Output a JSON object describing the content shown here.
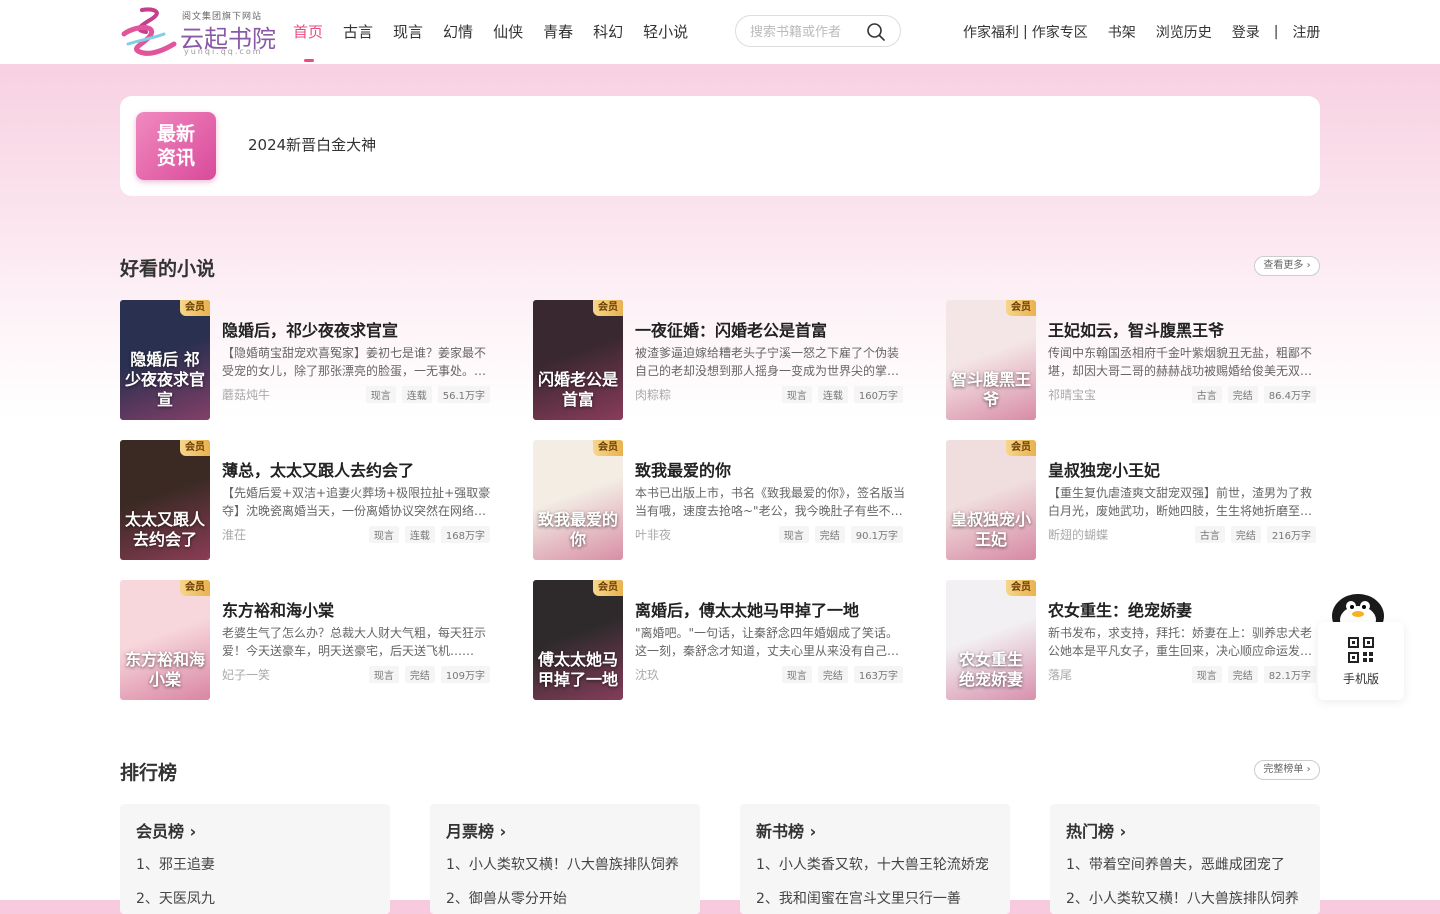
{
  "header": {
    "logo": {
      "slogan": "阅文集团旗下网站",
      "name": "云起书院",
      "url": "yunqi.qq.com"
    },
    "nav": [
      "首页",
      "古言",
      "现言",
      "幻情",
      "仙侠",
      "青春",
      "科幻",
      "轻小说"
    ],
    "search": {
      "placeholder": "搜索书籍或作者"
    },
    "user_nav": {
      "author_perks": "作家福利",
      "separator1": "|",
      "author_zone": "作家专区",
      "bookshelf": "书架",
      "history": "浏览历史",
      "login": "登录",
      "separator2": "|",
      "register": "注册"
    }
  },
  "news": {
    "badge": "最新资讯",
    "text": "2024新晋白金大神"
  },
  "recommend": {
    "title": "好看的小说",
    "more": "查看更多 ›",
    "books": [
      {
        "title": "隐婚后，祁少夜夜求官宣",
        "desc": "【隐婚萌宝甜宠欢喜冤家】姜初七是谁？姜家最不受宠的女儿，除了那张漂亮的脸蛋，一无事处。姜家…",
        "author": "蘑菇炖牛",
        "tags": [
          "现言",
          "连载",
          "56.1万字"
        ],
        "cover_text": "隐婚后 祁少夜夜求官宣",
        "vip": "会员",
        "cover_color": "#2a3050"
      },
      {
        "title": "一夜征婚：闪婚老公是首富",
        "desc": "被渣爹逼迫嫁给糟老头子宁溪一怒之下雇了个伪装自己的老却没想到那人摇身一变成为世界尖的掌权者…",
        "author": "肉粽粽",
        "tags": [
          "现言",
          "连载",
          "160万字"
        ],
        "cover_text": "闪婚老公是首富",
        "vip": "会员",
        "cover_color": "#3a2830"
      },
      {
        "title": "王妃如云，智斗腹黑王爷",
        "desc": "传闻中东翰国丞相府千金叶紫烟貌丑无盐，粗鄙不堪，却因大哥二哥的赫赫战功被赐婚给俊美无双的…",
        "author": "祁晴宝宝",
        "tags": [
          "古言",
          "完结",
          "86.4万字"
        ],
        "cover_text": "智斗腹黑王爷",
        "vip": "会员",
        "cover_color": "#f4e6e6"
      },
      {
        "title": "薄总，太太又跟人去约会了",
        "desc": "【先婚后爱+双洁+追妻火葬场+极限拉扯+强取豪夺】沈晚瓷离婚当天，一份离婚协议突然在网络上曝光…",
        "author": "淮茌",
        "tags": [
          "现言",
          "连载",
          "168万字"
        ],
        "cover_text": "太太又跟人去约会了",
        "vip": "会员",
        "cover_color": "#3b2a24"
      },
      {
        "title": "致我最爱的你",
        "desc": "本书已出版上市，书名《致我最爱的你》，签名版当当有哦，速度去抢咯~\"老公，我今晚肚子有些不舒服…",
        "author": "叶非夜",
        "tags": [
          "现言",
          "完结",
          "90.1万字"
        ],
        "cover_text": "致我最爱的你",
        "vip": "会员",
        "cover_color": "#f3ede4"
      },
      {
        "title": "皇叔独宠小王妃",
        "desc": "【重生复仇虐渣爽文甜宠双强】前世，渣男为了救白月光，废她武功，断她四肢，生生将她折磨至死…",
        "author": "断翅的蝴蝶",
        "tags": [
          "古言",
          "完结",
          "216万字"
        ],
        "cover_text": "皇叔独宠小王妃",
        "vip": "会员",
        "cover_color": "#f0dede"
      },
      {
        "title": "东方裕和海小棠",
        "desc": "老婆生气了怎么办？总裁大人财大气粗，每天狂示爱！今天送豪车，明天送豪宅，后天送飞机……",
        "author": "妃子一笑",
        "tags": [
          "现言",
          "完结",
          "109万字"
        ],
        "cover_text": "东方裕和海小棠",
        "vip": "会员",
        "cover_color": "#f7d7dc"
      },
      {
        "title": "离婚后，傅太太她马甲掉了一地",
        "desc": "\"离婚吧。\"一句话，让秦舒念四年婚姻成了笑话。这一刻，秦舒念才知道，丈夫心里从来没有自己…",
        "author": "沈玖",
        "tags": [
          "现言",
          "完结",
          "163万字"
        ],
        "cover_text": "傅太太她马甲掉了一地",
        "vip": "会员",
        "cover_color": "#2e2a2c"
      },
      {
        "title": "农女重生：绝宠娇妻",
        "desc": "新书发布，求支持，拜托：娇妻在上：驯养忠犬老公她本是平凡女子，重生回来，决心顺应命运发展…",
        "author": "落尾",
        "tags": [
          "现言",
          "完结",
          "82.1万字"
        ],
        "cover_text": "农女重生 绝宠娇妻",
        "vip": "会员",
        "cover_color": "#f2f0f2"
      }
    ]
  },
  "ranking": {
    "title": "排行榜",
    "more": "完整榜单 ›",
    "lists": [
      {
        "name": "会员榜 ›",
        "items": [
          "1、邪王追妻",
          "2、天医凤九"
        ]
      },
      {
        "name": "月票榜 ›",
        "items": [
          "1、小人类软又横！八大兽族排队饲养",
          "2、御兽从零分开始"
        ]
      },
      {
        "name": "新书榜 ›",
        "items": [
          "1、小人类香又软，十大兽王轮流娇宠",
          "2、我和闺蜜在宫斗文里只行一善"
        ]
      },
      {
        "name": "热门榜 ›",
        "items": [
          "1、带着空间养兽夫，恶雌成团宠了",
          "2、小人类软又横！八大兽族排队饲养"
        ]
      }
    ]
  },
  "float": {
    "label": "手机版"
  }
}
